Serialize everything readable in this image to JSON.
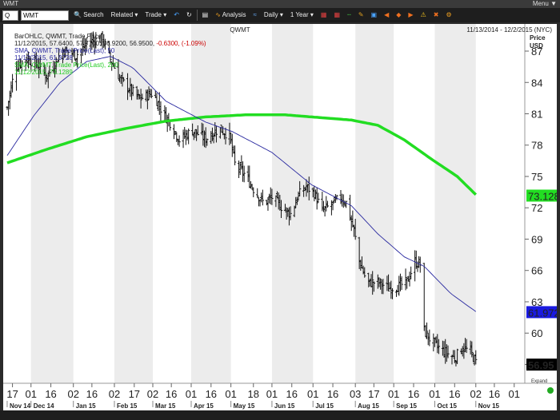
{
  "window": {
    "title": "WMT",
    "menu_label": "Menu",
    "caret": "▼"
  },
  "toolbar": {
    "dropdown_value": "Q",
    "symbol_value": "WMT",
    "search_label": "Search",
    "related_label": "Related",
    "trade_label": "Trade",
    "analysis_label": "Analysis",
    "interval_label": "Daily",
    "range_label": "1 Year"
  },
  "chart": {
    "symbol": "QWMT",
    "date_range": "11/13/2014 - 12/2/2015 (NYC)",
    "price_axis_title": "Price",
    "currency": "USD",
    "legend": {
      "bar_title": "BarOHLC, QWMT, Trade Price",
      "bar_values_prefix": "11/12/2015, 57.6400, 57.7700, 56.9200, 56.9500, ",
      "bar_change": "-0.6300, (-1.09%)",
      "sma50_title": "SMA, QWMT, Trade Price(Last), 50",
      "sma50_value": "11/12/2015, 61.9728",
      "sma200_title": "SMA, QWMT, Trade Price(Last), 200",
      "sma200_value": "11/12/2015, 73.1289"
    },
    "badges": {
      "sma200": "73.128",
      "sma50": "61.972",
      "last": "56.95"
    },
    "collapse_label": "Expand",
    "colors": {
      "sma50": "#2a2aa0",
      "sma200": "#22dd22",
      "last_badge": "#000000",
      "sma50_badge": "#1a1ae0",
      "sma200_badge": "#22dd22",
      "change": "#cc0000",
      "shade": "#ececec"
    }
  },
  "chart_data": {
    "type": "ohlc",
    "title": "QWMT",
    "ylim": [
      55.2,
      89.6
    ],
    "y_ticks": [
      57,
      60,
      63,
      66,
      69,
      72,
      75,
      78,
      81,
      84,
      87
    ],
    "x_ticks": [
      "17",
      "01",
      "16",
      "02",
      "16",
      "02",
      "17",
      "02",
      "16",
      "01",
      "16",
      "01",
      "18",
      "01",
      "16",
      "01",
      "16",
      "03",
      "17",
      "01",
      "16",
      "01",
      "16",
      "02",
      "16",
      "01"
    ],
    "x_tick_days": [
      4,
      18,
      33,
      50,
      64,
      81,
      96,
      110,
      124,
      139,
      154,
      169,
      186,
      200,
      215,
      231,
      246,
      263,
      277,
      292,
      307,
      323,
      338,
      354,
      368,
      383
    ],
    "months": [
      "Nov 14",
      "Dec 14",
      "Jan 15",
      "Feb 15",
      "Mar 15",
      "Apr 15",
      "May 15",
      "Jun 15",
      "Jul 15",
      "Aug 15",
      "Sep 15",
      "Oct 15",
      "Nov 15"
    ],
    "month_days": [
      0,
      18,
      50,
      81,
      110,
      139,
      169,
      200,
      231,
      263,
      292,
      323,
      354
    ],
    "price_keyframes": [
      {
        "day": 0,
        "close": 81.6
      },
      {
        "day": 6,
        "close": 85.4
      },
      {
        "day": 14,
        "close": 86.3
      },
      {
        "day": 22,
        "close": 85.8
      },
      {
        "day": 30,
        "close": 84.6
      },
      {
        "day": 42,
        "close": 87.1
      },
      {
        "day": 52,
        "close": 86.6
      },
      {
        "day": 62,
        "close": 87.9
      },
      {
        "day": 72,
        "close": 88.2
      },
      {
        "day": 78,
        "close": 86.2
      },
      {
        "day": 86,
        "close": 84.2
      },
      {
        "day": 100,
        "close": 82.4
      },
      {
        "day": 110,
        "close": 83.0
      },
      {
        "day": 118,
        "close": 81.0
      },
      {
        "day": 124,
        "close": 80.0
      },
      {
        "day": 130,
        "close": 78.5
      },
      {
        "day": 140,
        "close": 79.4
      },
      {
        "day": 150,
        "close": 78.6
      },
      {
        "day": 160,
        "close": 79.6
      },
      {
        "day": 168,
        "close": 78.9
      },
      {
        "day": 172,
        "close": 76.2
      },
      {
        "day": 180,
        "close": 75.1
      },
      {
        "day": 186,
        "close": 73.8
      },
      {
        "day": 194,
        "close": 72.4
      },
      {
        "day": 200,
        "close": 73.0
      },
      {
        "day": 208,
        "close": 72.0
      },
      {
        "day": 214,
        "close": 71.4
      },
      {
        "day": 220,
        "close": 73.2
      },
      {
        "day": 226,
        "close": 74.0
      },
      {
        "day": 232,
        "close": 73.4
      },
      {
        "day": 238,
        "close": 71.7
      },
      {
        "day": 246,
        "close": 72.4
      },
      {
        "day": 252,
        "close": 73.0
      },
      {
        "day": 256,
        "close": 72.5
      },
      {
        "day": 262,
        "close": 69.8
      },
      {
        "day": 266,
        "close": 66.9
      },
      {
        "day": 272,
        "close": 64.8
      },
      {
        "day": 280,
        "close": 64.9
      },
      {
        "day": 288,
        "close": 64.3
      },
      {
        "day": 296,
        "close": 64.5
      },
      {
        "day": 302,
        "close": 64.9
      },
      {
        "day": 308,
        "close": 66.8
      },
      {
        "day": 312,
        "close": 66.6
      },
      {
        "day": 314,
        "close": 60.4
      },
      {
        "day": 320,
        "close": 59.3
      },
      {
        "day": 326,
        "close": 58.6
      },
      {
        "day": 332,
        "close": 58.1
      },
      {
        "day": 338,
        "close": 57.6
      },
      {
        "day": 344,
        "close": 58.6
      },
      {
        "day": 350,
        "close": 58.2
      },
      {
        "day": 355,
        "close": 56.95
      }
    ],
    "sma50_keyframes": [
      {
        "day": 0,
        "v": 77.0
      },
      {
        "day": 20,
        "v": 80.8
      },
      {
        "day": 40,
        "v": 84.0
      },
      {
        "day": 60,
        "v": 86.0
      },
      {
        "day": 78,
        "v": 86.5
      },
      {
        "day": 95,
        "v": 85.4
      },
      {
        "day": 120,
        "v": 82.2
      },
      {
        "day": 150,
        "v": 80.2
      },
      {
        "day": 170,
        "v": 79.3
      },
      {
        "day": 200,
        "v": 77.3
      },
      {
        "day": 230,
        "v": 74.2
      },
      {
        "day": 260,
        "v": 72.2
      },
      {
        "day": 280,
        "v": 69.5
      },
      {
        "day": 300,
        "v": 67.3
      },
      {
        "day": 315,
        "v": 66.4
      },
      {
        "day": 335,
        "v": 63.8
      },
      {
        "day": 355,
        "v": 61.97
      }
    ],
    "sma200_keyframes": [
      {
        "day": 0,
        "v": 76.3
      },
      {
        "day": 30,
        "v": 77.6
      },
      {
        "day": 60,
        "v": 78.8
      },
      {
        "day": 90,
        "v": 79.6
      },
      {
        "day": 120,
        "v": 80.3
      },
      {
        "day": 150,
        "v": 80.7
      },
      {
        "day": 180,
        "v": 80.9
      },
      {
        "day": 210,
        "v": 80.9
      },
      {
        "day": 240,
        "v": 80.6
      },
      {
        "day": 260,
        "v": 80.4
      },
      {
        "day": 280,
        "v": 79.9
      },
      {
        "day": 300,
        "v": 78.5
      },
      {
        "day": 320,
        "v": 76.7
      },
      {
        "day": 340,
        "v": 75.0
      },
      {
        "day": 355,
        "v": 73.13
      }
    ]
  }
}
